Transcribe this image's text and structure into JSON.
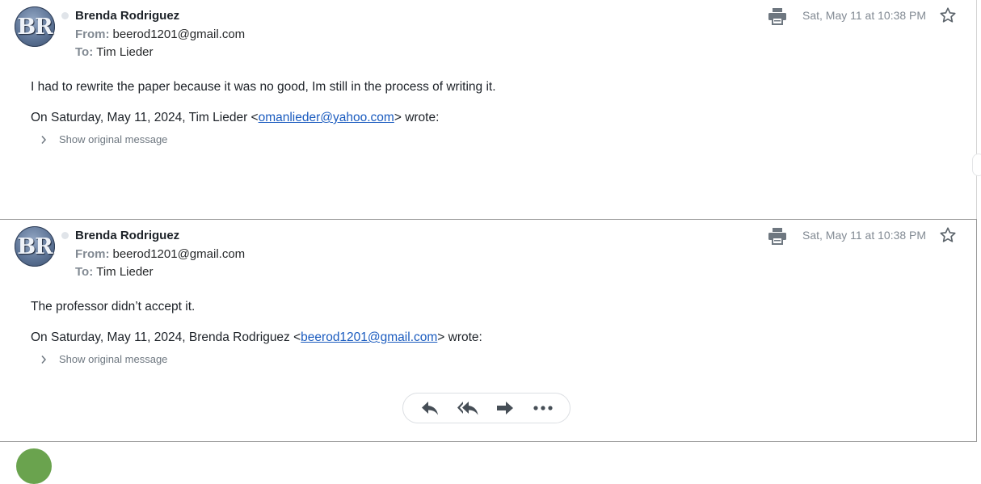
{
  "messages": [
    {
      "avatar_initials": "BR",
      "sender": "Brenda Rodriguez",
      "from_label": "From:",
      "from_email": "beerod1201@gmail.com",
      "to_label": "To:",
      "to_name": "Tim Lieder",
      "date": "Sat, May 11 at 10:38 PM",
      "body": "I had to rewrite the paper because it was no good, Im still in the process of writing it.",
      "quote_prefix": "On Saturday, May 11, 2024, Tim Lieder <",
      "quote_email": "omanlieder@yahoo.com",
      "quote_suffix": "> wrote:",
      "show_original": "Show original message"
    },
    {
      "avatar_initials": "BR",
      "sender": "Brenda Rodriguez",
      "from_label": "From:",
      "from_email": "beerod1201@gmail.com",
      "to_label": "To:",
      "to_name": "Tim Lieder",
      "date": "Sat, May 11 at 10:38 PM",
      "body": "The professor didn’t accept it.",
      "quote_prefix": "On Saturday, May 11, 2024, Brenda Rodriguez <",
      "quote_email": "beerod1201@gmail.com",
      "quote_suffix": "> wrote:",
      "show_original": "Show original message"
    }
  ],
  "actions": {
    "icons": [
      "reply-icon",
      "reply-all-icon",
      "forward-icon",
      "more-icon"
    ]
  },
  "colors": {
    "link": "#1a5bbf",
    "muted": "#828a93",
    "text": "#1d2228"
  }
}
